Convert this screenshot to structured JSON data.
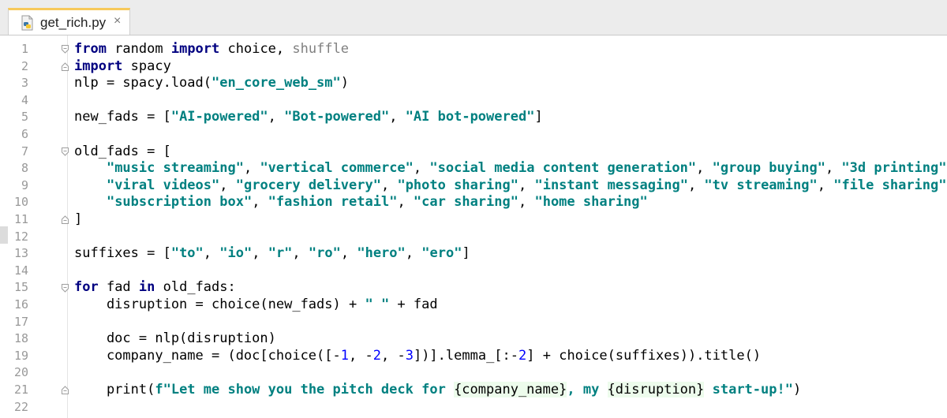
{
  "tab": {
    "filename": "get_rich.py",
    "close_glyph": "×",
    "icon": "python-file-icon"
  },
  "colors": {
    "keyword": "#000080",
    "string": "#008080",
    "number": "#0000ff",
    "unused_import": "#808080",
    "fstring_bg": "#edfcec"
  },
  "gutter": {
    "line_numbers": [
      "1",
      "2",
      "3",
      "4",
      "5",
      "6",
      "7",
      "8",
      "9",
      "10",
      "11",
      "12",
      "13",
      "14",
      "15",
      "16",
      "17",
      "18",
      "19",
      "20",
      "21",
      "22"
    ]
  },
  "code": {
    "lines": [
      [
        [
          "kw",
          "from"
        ],
        [
          "p",
          " random "
        ],
        [
          "kw",
          "import"
        ],
        [
          "p",
          " choice, "
        ],
        [
          "g",
          "shuffle"
        ]
      ],
      [
        [
          "kw",
          "import"
        ],
        [
          "p",
          " spacy"
        ]
      ],
      [
        [
          "p",
          "nlp = spacy.load("
        ],
        [
          "s",
          "\"en_core_web_sm\""
        ],
        [
          "p",
          ")"
        ]
      ],
      [],
      [
        [
          "p",
          "new_fads = ["
        ],
        [
          "s",
          "\"AI-powered\""
        ],
        [
          "p",
          ", "
        ],
        [
          "s",
          "\"Bot-powered\""
        ],
        [
          "p",
          ", "
        ],
        [
          "s",
          "\"AI bot-powered\""
        ],
        [
          "p",
          "]"
        ]
      ],
      [],
      [
        [
          "p",
          "old_fads = ["
        ]
      ],
      [
        [
          "p",
          "    "
        ],
        [
          "s",
          "\"music streaming\""
        ],
        [
          "p",
          ", "
        ],
        [
          "s",
          "\"vertical commerce\""
        ],
        [
          "p",
          ", "
        ],
        [
          "s",
          "\"social media content generation\""
        ],
        [
          "p",
          ", "
        ],
        [
          "s",
          "\"group buying\""
        ],
        [
          "p",
          ", "
        ],
        [
          "s",
          "\"3d printing\""
        ],
        [
          "p",
          ","
        ]
      ],
      [
        [
          "p",
          "    "
        ],
        [
          "s",
          "\"viral videos\""
        ],
        [
          "p",
          ", "
        ],
        [
          "s",
          "\"grocery delivery\""
        ],
        [
          "p",
          ", "
        ],
        [
          "s",
          "\"photo sharing\""
        ],
        [
          "p",
          ", "
        ],
        [
          "s",
          "\"instant messaging\""
        ],
        [
          "p",
          ", "
        ],
        [
          "s",
          "\"tv streaming\""
        ],
        [
          "p",
          ", "
        ],
        [
          "s",
          "\"file sharing\""
        ],
        [
          "p",
          ","
        ]
      ],
      [
        [
          "p",
          "    "
        ],
        [
          "s",
          "\"subscription box\""
        ],
        [
          "p",
          ", "
        ],
        [
          "s",
          "\"fashion retail\""
        ],
        [
          "p",
          ", "
        ],
        [
          "s",
          "\"car sharing\""
        ],
        [
          "p",
          ", "
        ],
        [
          "s",
          "\"home sharing\""
        ]
      ],
      [
        [
          "p",
          "]"
        ]
      ],
      [],
      [
        [
          "p",
          "suffixes = ["
        ],
        [
          "s",
          "\"to\""
        ],
        [
          "p",
          ", "
        ],
        [
          "s",
          "\"io\""
        ],
        [
          "p",
          ", "
        ],
        [
          "s",
          "\"r\""
        ],
        [
          "p",
          ", "
        ],
        [
          "s",
          "\"ro\""
        ],
        [
          "p",
          ", "
        ],
        [
          "s",
          "\"hero\""
        ],
        [
          "p",
          ", "
        ],
        [
          "s",
          "\"ero\""
        ],
        [
          "p",
          "]"
        ]
      ],
      [],
      [
        [
          "kw",
          "for"
        ],
        [
          "p",
          " fad "
        ],
        [
          "kw",
          "in"
        ],
        [
          "p",
          " old_fads:"
        ]
      ],
      [
        [
          "p",
          "    disruption = choice(new_fads) + "
        ],
        [
          "s",
          "\" \""
        ],
        [
          "p",
          " + fad"
        ]
      ],
      [],
      [
        [
          "p",
          "    doc = nlp(disruption)"
        ]
      ],
      [
        [
          "p",
          "    company_name = (doc[choice([-"
        ],
        [
          "n",
          "1"
        ],
        [
          "p",
          ", -"
        ],
        [
          "n",
          "2"
        ],
        [
          "p",
          ", -"
        ],
        [
          "n",
          "3"
        ],
        [
          "p",
          "])].lemma_[:-"
        ],
        [
          "n",
          "2"
        ],
        [
          "p",
          "] + choice(suffixes)).title()"
        ]
      ],
      [],
      [
        [
          "p",
          "    print("
        ],
        [
          "s",
          "f\"Let me show you the pitch deck for "
        ],
        [
          "f",
          "{company_name}"
        ],
        [
          "s",
          ", my "
        ],
        [
          "f",
          "{disruption}"
        ],
        [
          "s",
          " start-up!\""
        ],
        [
          "p",
          ")"
        ]
      ],
      []
    ]
  }
}
